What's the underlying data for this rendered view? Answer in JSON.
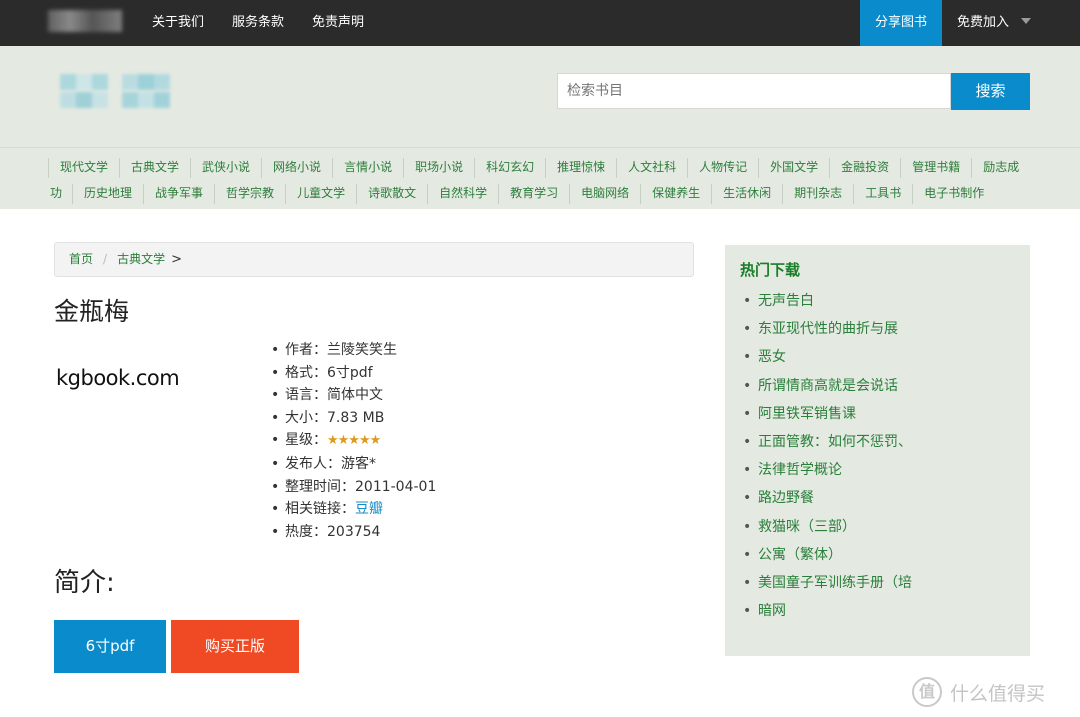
{
  "topbar": {
    "nav": [
      "关于我们",
      "服务条款",
      "免责声明"
    ],
    "share_label": "分享图书",
    "join_label": "免费加入"
  },
  "search": {
    "placeholder": "检索书目",
    "button_label": "搜索"
  },
  "categories": {
    "row1": [
      "现代文学",
      "古典文学",
      "武侠小说",
      "网络小说",
      "言情小说",
      "职场小说",
      "科幻玄幻",
      "推理惊悚",
      "人文社科",
      "人物传记",
      "外国文学",
      "金融投资",
      "管理书籍",
      "励志成"
    ],
    "row2_lead": "功",
    "row2": [
      "历史地理",
      "战争军事",
      "哲学宗教",
      "儿童文学",
      "诗歌散文",
      "自然科学",
      "教育学习",
      "电脑网络",
      "保健养生",
      "生活休闲",
      "期刊杂志",
      "工具书",
      "电子书制作"
    ]
  },
  "breadcrumb": {
    "home": "首页",
    "sep": "/",
    "category": "古典文学",
    "trail": ">"
  },
  "book": {
    "title": "金瓶梅",
    "cover_text": "kgbook.com",
    "author_label": "作者：",
    "author": "兰陵笑笑生",
    "format_label": "格式：",
    "format": "6寸pdf",
    "language_label": "语言：",
    "language": "简体中文",
    "size_label": "大小：",
    "size": "7.83 MB",
    "rating_label": "星级：",
    "rating": 5,
    "rating_max": 5,
    "stars": "★★★★★",
    "publisher_label": "发布人：",
    "publisher": "游客*",
    "date_label": "整理时间：",
    "date": "2011-04-01",
    "links_label": "相关链接：",
    "link": "豆瓣",
    "heat_label": "热度：",
    "heat": "203754"
  },
  "intro_heading": "简介:",
  "actions": {
    "download_label": "6寸pdf",
    "buy_label": "购买正版"
  },
  "sidebar": {
    "title": "热门下载",
    "items": [
      "无声告白",
      "东亚现代性的曲折与展",
      "恶女",
      "所谓情商高就是会说话",
      "阿里铁军销售课",
      "正面管教：如何不惩罚、",
      "法律哲学概论",
      "路边野餐",
      "救猫咪（三部）",
      "公寓（繁体）",
      "美国童子军训练手册（培",
      "暗网"
    ]
  },
  "watermark": {
    "icon": "值",
    "text": "什么值得买"
  },
  "colors": {
    "topbar": "#2b2b2b",
    "accent_blue": "#0a8ccc",
    "buy_red": "#f04a24",
    "band_green": "#e4eae2",
    "link_green": "#2a7f3a"
  }
}
